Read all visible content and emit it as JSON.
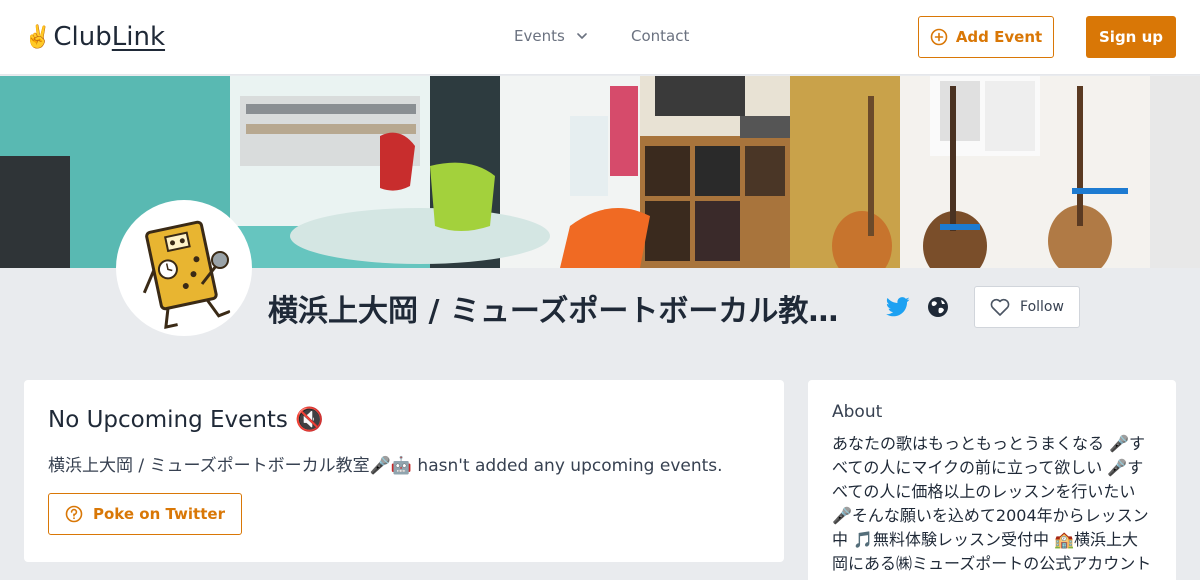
{
  "nav": {
    "logo_emoji": "✌️",
    "logo_club": "Club",
    "logo_link": "Link",
    "events_label": "Events",
    "contact_label": "Contact",
    "add_event_label": "Add Event",
    "signup_label": "Sign up"
  },
  "profile": {
    "name": "横浜上大岡 / ミューズポートボーカル教室🎤🤖",
    "follow_label": "Follow"
  },
  "events": {
    "title": "No Upcoming Events 🔇",
    "description": "横浜上大岡 / ミューズポートボーカル教室🎤🤖 hasn't added any upcoming events.",
    "poke_label": "Poke on Twitter"
  },
  "about": {
    "title": "About",
    "text": "あなたの歌はもっともっとうまくなる 🎤すべての人にマイクの前に立って欲しい 🎤すべての人に価格以上のレッスンを行いたい 🎤そんな願いを込めて2004年からレッスン中 🎵無料体験レッスン受付中 🏫横浜上大岡にある㈱ミューズポートの公式アカウント"
  },
  "colors": {
    "accent": "#d97706",
    "twitter": "#1da1f2",
    "background": "#e9ebee"
  },
  "icons": [
    "chevron-down-icon",
    "plus-circle-icon",
    "twitter-icon",
    "globe-icon",
    "heart-icon",
    "question-circle-icon"
  ]
}
